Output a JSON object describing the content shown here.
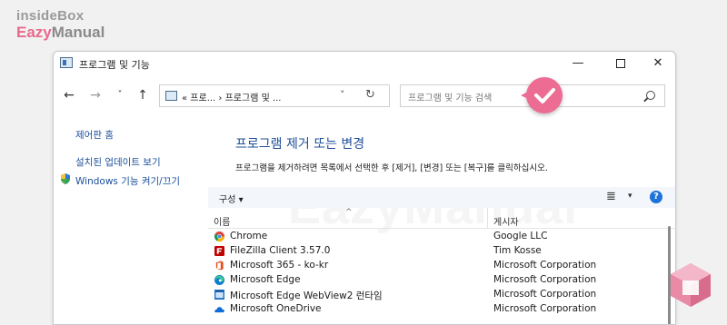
{
  "brand": {
    "line1": "insideBox",
    "line2_a": "Eazy",
    "line2_b": "Manual"
  },
  "window": {
    "title": "프로그램 및 기능",
    "minimize": "—",
    "maximize": "",
    "close": "✕"
  },
  "nav": {
    "back": "←",
    "forward": "→",
    "recent": "˅",
    "up": "↑",
    "address": "« 프로...  ›  프로그램 및 ...",
    "address_dropdown": "˅",
    "refresh": "↻",
    "search_placeholder": "프로그램 및 기능 검색"
  },
  "sidebar": {
    "items": [
      {
        "label": "제어판 홈"
      },
      {
        "label": "설치된 업데이트 보기"
      },
      {
        "label": "Windows 기능 켜기/끄기"
      }
    ]
  },
  "main": {
    "title": "프로그램 제거 또는 변경",
    "description": "프로그램을 제거하려면 목록에서 선택한 후 [제거], [변경] 또는 [복구]를 클릭하십시오."
  },
  "toolbar": {
    "organize": "구성 ▾",
    "view": "≣",
    "view_dropdown": "▾",
    "help": "?"
  },
  "columns": {
    "name": "이름",
    "sort": "^",
    "publisher": "게시자"
  },
  "programs": [
    {
      "name": "Chrome",
      "publisher": "Google LLC",
      "icon": "chrome-icon"
    },
    {
      "name": "FileZilla Client 3.57.0",
      "publisher": "Tim Kosse",
      "icon": "filezilla-icon"
    },
    {
      "name": "Microsoft 365 - ko-kr",
      "publisher": "Microsoft Corporation",
      "icon": "office-icon"
    },
    {
      "name": "Microsoft Edge",
      "publisher": "Microsoft Corporation",
      "icon": "edge-icon"
    },
    {
      "name": "Microsoft Edge WebView2 런타임",
      "publisher": "Microsoft Corporation",
      "icon": "webview2-icon"
    },
    {
      "name": "Microsoft OneDrive",
      "publisher": "Microsoft Corporation",
      "icon": "onedrive-icon"
    }
  ],
  "colors": {
    "accent_link": "#1e4f9a",
    "check_badge": "#ec6c93",
    "help_blue": "#1d73d8"
  }
}
